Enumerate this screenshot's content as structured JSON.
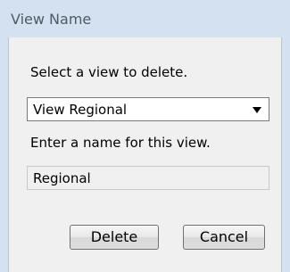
{
  "window": {
    "title": "View Name"
  },
  "form": {
    "select_label": "Select a view to delete.",
    "selected_view": "View Regional",
    "name_label": "Enter a name for this view.",
    "name_value": "Regional"
  },
  "buttons": {
    "delete": "Delete",
    "cancel": "Cancel"
  },
  "colors": {
    "frame": "#d4e1f0",
    "client": "#f0f0f0",
    "title_text": "#505a66"
  },
  "icons": {
    "dropdown": "chevron-down-icon"
  }
}
